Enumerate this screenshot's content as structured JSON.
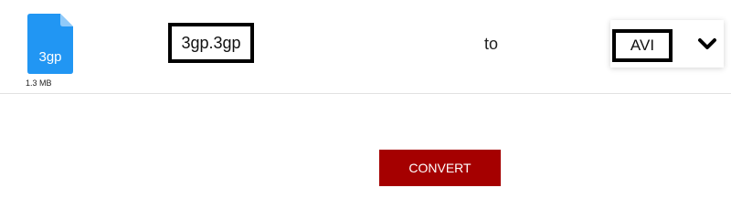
{
  "file": {
    "extension": "3gp",
    "size": "1.3 MB",
    "name": "3gp.3gp",
    "icon": "file-icon",
    "icon_color": "#2196F3"
  },
  "conversion": {
    "to_label": "to",
    "target_format": "AVI",
    "dropdown_icon": "chevron-down-icon"
  },
  "actions": {
    "convert_label": "CONVERT",
    "convert_color": "#A50000"
  }
}
